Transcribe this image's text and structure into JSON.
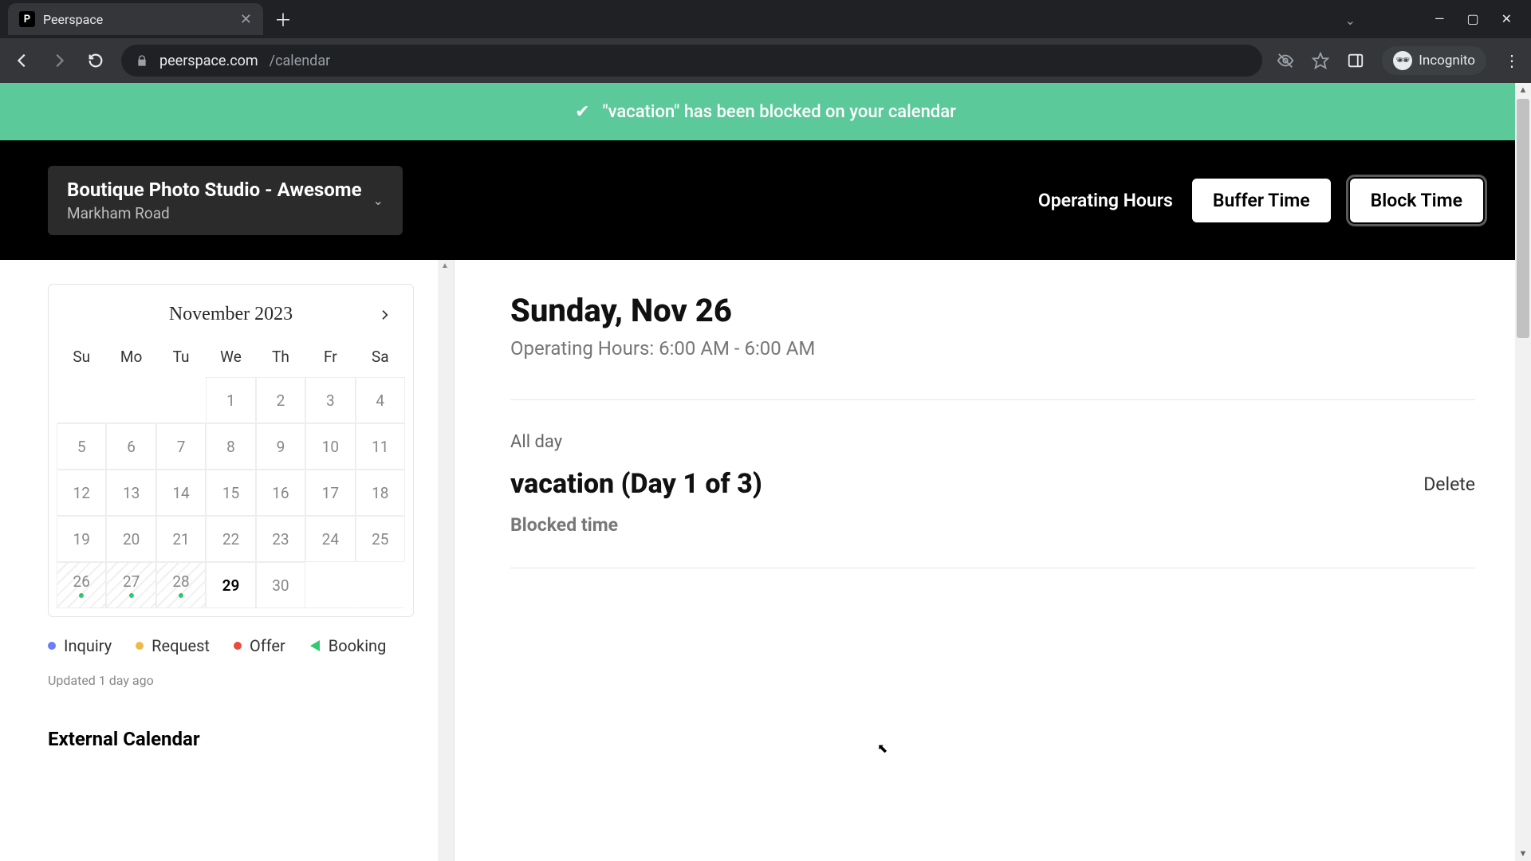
{
  "browser": {
    "tab_title": "Peerspace",
    "favicon_letter": "P",
    "url_domain": "peerspace.com",
    "url_path": "/calendar",
    "incognito_label": "Incognito"
  },
  "banner": {
    "message": "\"vacation\" has been blocked on your calendar"
  },
  "header": {
    "space_title": "Boutique Photo Studio - Awesome",
    "space_subtitle": "Markham Road",
    "operating_hours_label": "Operating Hours",
    "buffer_time_label": "Buffer Time",
    "block_time_label": "Block Time"
  },
  "calendar": {
    "month_label": "November 2023",
    "dows": [
      "Su",
      "Mo",
      "Tu",
      "We",
      "Th",
      "Fr",
      "Sa"
    ],
    "leading_blanks": 3,
    "days": [
      {
        "n": 1
      },
      {
        "n": 2
      },
      {
        "n": 3
      },
      {
        "n": 4
      },
      {
        "n": 5
      },
      {
        "n": 6
      },
      {
        "n": 7
      },
      {
        "n": 8
      },
      {
        "n": 9
      },
      {
        "n": 10
      },
      {
        "n": 11
      },
      {
        "n": 12
      },
      {
        "n": 13
      },
      {
        "n": 14
      },
      {
        "n": 15
      },
      {
        "n": 16
      },
      {
        "n": 17
      },
      {
        "n": 18
      },
      {
        "n": 19
      },
      {
        "n": 20
      },
      {
        "n": 21
      },
      {
        "n": 22
      },
      {
        "n": 23
      },
      {
        "n": 24
      },
      {
        "n": 25
      },
      {
        "n": 26,
        "striped": true,
        "dot": true
      },
      {
        "n": 27,
        "striped": true,
        "dot": true
      },
      {
        "n": 28,
        "striped": true,
        "dot": true
      },
      {
        "n": 29,
        "current": true
      },
      {
        "n": 30
      }
    ],
    "trailing_blanks": 2,
    "legend": {
      "inquiry": {
        "label": "Inquiry",
        "color": "#6a7cff"
      },
      "request": {
        "label": "Request",
        "color": "#f0b94a"
      },
      "offer": {
        "label": "Offer",
        "color": "#e74c3c"
      },
      "booking": {
        "label": "Booking"
      }
    },
    "updated_text": "Updated 1 day ago",
    "external_heading": "External Calendar"
  },
  "detail": {
    "day_title": "Sunday, Nov 26",
    "operating_hours_text": "Operating Hours: 6:00 AM - 6:00 AM",
    "allday_label": "All day",
    "event_title": "vacation (Day 1 of 3)",
    "delete_label": "Delete",
    "blocked_label": "Blocked time"
  }
}
